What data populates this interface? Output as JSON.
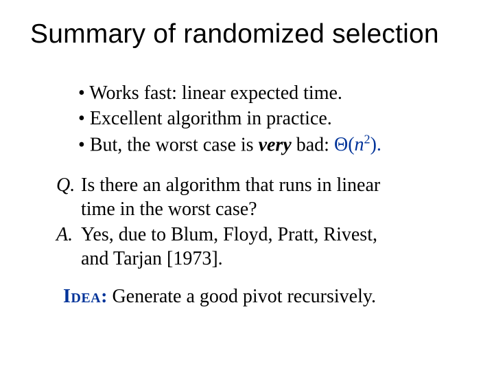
{
  "title": "Summary of randomized selection",
  "bullets": [
    {
      "dot": "• ",
      "text": "Works fast: linear expected time."
    },
    {
      "dot": "• ",
      "text": "Excellent algorithm in practice."
    },
    {
      "dot": "• ",
      "prefix": "But, the worst case is ",
      "very": "very",
      "suffix": " bad: ",
      "theta_open": "Θ(",
      "theta_n": "n",
      "theta_sup": "2",
      "theta_close": ")."
    }
  ],
  "qa": {
    "q_label": "Q.",
    "q_text1": "Is there an algorithm that runs in linear",
    "q_text2": "time in the worst case?",
    "a_label": "A.",
    "a_text1": "Yes, due to Blum, Floyd, Pratt, Rivest,",
    "a_text2": "and Tarjan [1973]."
  },
  "idea": {
    "label": "Idea",
    "colon": ":",
    "text": " Generate a good pivot recursively."
  }
}
